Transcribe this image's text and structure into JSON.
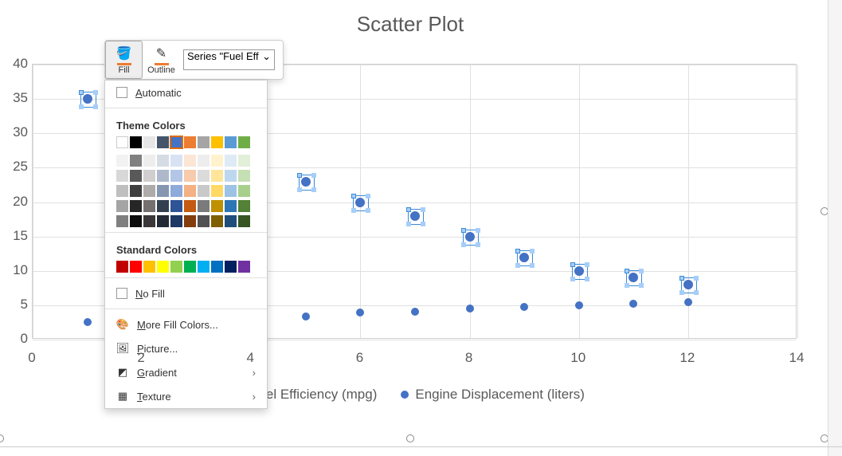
{
  "chart_data": {
    "type": "scatter",
    "title": "Scatter Plot",
    "xlabel": "",
    "ylabel": "",
    "xlim": [
      0,
      14
    ],
    "ylim": [
      0,
      40
    ],
    "x_ticks": [
      0,
      2,
      4,
      6,
      8,
      10,
      12,
      14
    ],
    "y_ticks": [
      0,
      5,
      10,
      15,
      20,
      25,
      30,
      35,
      40
    ],
    "series": [
      {
        "name": "Fuel Efficiency (mpg)",
        "selected": true,
        "x": [
          1,
          5,
          6,
          7,
          8,
          9,
          10,
          11,
          12
        ],
        "y": [
          35,
          23,
          20,
          18,
          15,
          12,
          10,
          9,
          8
        ]
      },
      {
        "name": "Engine Displacement (liters)",
        "selected": false,
        "x": [
          1,
          5,
          6,
          7,
          8,
          9,
          10,
          11,
          12
        ],
        "y": [
          2.5,
          3.4,
          3.9,
          4.1,
          4.5,
          4.7,
          5.0,
          5.2,
          5.4
        ]
      }
    ],
    "legend_position": "bottom",
    "grid": true
  },
  "toolbar": {
    "fill_label": "Fill",
    "outline_label": "Outline",
    "fill_accent": "#ed7d31",
    "outline_accent": "#ed7d31",
    "series_selector_value": "Series \"Fuel Eff"
  },
  "fill_menu": {
    "automatic_label": "Automatic",
    "theme_header": "Theme Colors",
    "standard_header": "Standard Colors",
    "no_fill_label": "No Fill",
    "more_colors_label": "More Fill Colors...",
    "picture_label": "Picture...",
    "gradient_label": "Gradient",
    "texture_label": "Texture",
    "theme_row1": [
      "#ffffff",
      "#000000",
      "#e7e6e6",
      "#44546a",
      "#4472c4",
      "#ed7d31",
      "#a5a5a5",
      "#ffc000",
      "#5b9bd5",
      "#70ad47"
    ],
    "theme_selected_index": 4,
    "theme_shades": [
      [
        "#f2f2f2",
        "#808080",
        "#eeeded",
        "#d6dce4",
        "#d9e2f3",
        "#fbe5d5",
        "#ededed",
        "#fff2cc",
        "#deebf6",
        "#e2efd9"
      ],
      [
        "#d8d8d8",
        "#595959",
        "#d0cece",
        "#adb9ca",
        "#b4c6e7",
        "#f7cbac",
        "#dbdbdb",
        "#fee599",
        "#bdd7ee",
        "#c5e0b3"
      ],
      [
        "#bfbfbf",
        "#3f3f3f",
        "#aeabab",
        "#8496b0",
        "#8eaadb",
        "#f4b183",
        "#c9c9c9",
        "#ffd965",
        "#9cc3e5",
        "#a8d08d"
      ],
      [
        "#a5a5a5",
        "#262626",
        "#757070",
        "#323f4f",
        "#2f5496",
        "#c55a11",
        "#7b7b7b",
        "#bf9000",
        "#2e75b5",
        "#538135"
      ],
      [
        "#7f7f7f",
        "#0c0c0c",
        "#3a3838",
        "#222a35",
        "#1f3864",
        "#833c0b",
        "#525252",
        "#7f6000",
        "#1e4e79",
        "#375623"
      ]
    ],
    "standard_colors": [
      "#c00000",
      "#ff0000",
      "#ffc000",
      "#ffff00",
      "#92d050",
      "#00b050",
      "#00b0f0",
      "#0070c0",
      "#002060",
      "#7030a0"
    ]
  }
}
